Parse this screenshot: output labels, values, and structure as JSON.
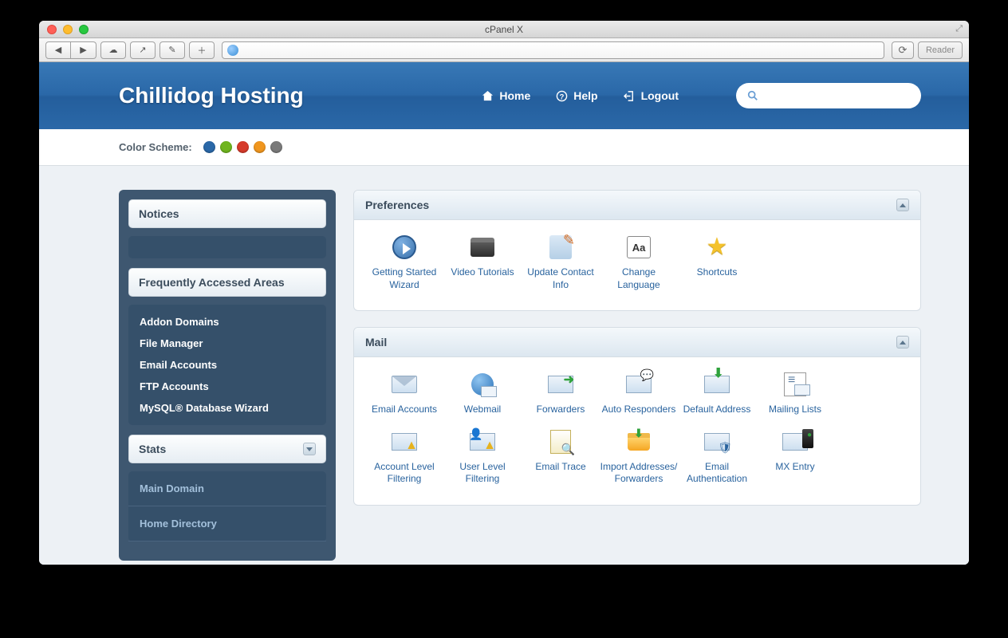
{
  "window": {
    "title": "cPanel X",
    "reader": "Reader"
  },
  "header": {
    "brand": "Chillidog Hosting",
    "nav": {
      "home": "Home",
      "help": "Help",
      "logout": "Logout"
    },
    "search_placeholder": ""
  },
  "scheme": {
    "label": "Color Scheme:",
    "colors": [
      "#2a68a8",
      "#6fb51e",
      "#d63a2a",
      "#f0961e",
      "#7a7a7a"
    ]
  },
  "sidebar": {
    "notices": {
      "title": "Notices"
    },
    "freq": {
      "title": "Frequently Accessed Areas",
      "items": [
        "Addon Domains",
        "File Manager",
        "Email Accounts",
        "FTP Accounts",
        "MySQL® Database Wizard"
      ]
    },
    "stats": {
      "title": "Stats",
      "items": [
        "Main Domain",
        "Home Directory"
      ]
    }
  },
  "panels": {
    "preferences": {
      "title": "Preferences",
      "apps": [
        {
          "label": "Getting Started Wizard",
          "icon": "play"
        },
        {
          "label": "Video Tutorials",
          "icon": "video"
        },
        {
          "label": "Update Contact Info",
          "icon": "contact"
        },
        {
          "label": "Change Language",
          "icon": "lang"
        },
        {
          "label": "Shortcuts",
          "icon": "star"
        }
      ]
    },
    "mail": {
      "title": "Mail",
      "apps": [
        {
          "label": "Email Accounts",
          "icon": "mail"
        },
        {
          "label": "Webmail",
          "icon": "webmail"
        },
        {
          "label": "Forwarders",
          "icon": "fwd"
        },
        {
          "label": "Auto Responders",
          "icon": "auto"
        },
        {
          "label": "Default Address",
          "icon": "default"
        },
        {
          "label": "Mailing Lists",
          "icon": "list"
        },
        {
          "label": "Account Level Filtering",
          "icon": "acclvl"
        },
        {
          "label": "User Level Filtering",
          "icon": "userlvl"
        },
        {
          "label": "Email Trace",
          "icon": "trace"
        },
        {
          "label": "Import Addresses/ Forwarders",
          "icon": "import"
        },
        {
          "label": "Email Authentication",
          "icon": "auth"
        },
        {
          "label": "MX Entry",
          "icon": "mx"
        }
      ]
    }
  }
}
